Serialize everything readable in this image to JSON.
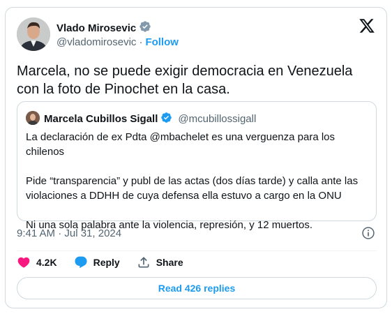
{
  "author": {
    "name": "Vlado Mirosevic",
    "handle": "@vladomirosevic",
    "follow_label": "Follow"
  },
  "tweet": {
    "text": "Marcela, no se puede exigir democracia en Venezuela con la foto de Pinochet en la casa."
  },
  "quoted": {
    "name": "Marcela Cubillos Sigall",
    "handle": "@mcubillossigall",
    "paragraphs": [
      "La declaración de ex Pdta @mbachelet es una verguenza para los chilenos",
      "Pide “transparencia” y publ de las actas (dos días tarde) y calla ante las violaciones a DDHH de cuya defensa ella estuvo a cargo en la ONU",
      "Ni una sola palabra ante la violencia, represión, y 12 muertos."
    ]
  },
  "meta": {
    "time": "9:41 AM · Jul 31, 2024"
  },
  "actions": {
    "like_count": "4.2K",
    "reply_label": "Reply",
    "share_label": "Share"
  },
  "read_replies": "Read 426 replies",
  "colors": {
    "accent": "#1d9bf0",
    "like": "#f91880",
    "verified": "#1d9bf0",
    "muted": "#536471"
  }
}
